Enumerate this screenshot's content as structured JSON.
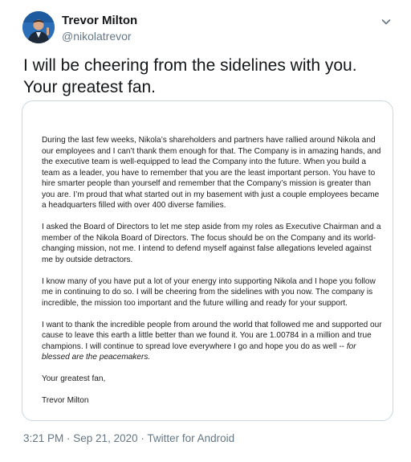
{
  "author": {
    "name": "Trevor Milton",
    "handle": "@nikolatrevor",
    "avatar": "avatar-photo"
  },
  "menu": {
    "icon": "chevron-down-icon"
  },
  "tweet": {
    "text": "I will be cheering from the sidelines with you. Your greatest fan."
  },
  "letter": {
    "paragraphs": [
      "During the last few weeks, Nikola’s shareholders and partners have rallied around Nikola and our employees and I can’t thank them enough for that.  The Company is in amazing hands, and the executive team is well-equipped to lead the Company into the future.  When you build a team as a leader, you have to remember that you are the least important person.  You have to hire smarter people than yourself and remember that the Company’s mission is greater than you are.  I’m proud that what started out in my basement with just a couple employees became a headquarters filled with over 400 diverse families.",
      "I asked the Board of Directors to let me step aside from my roles as Executive Chairman and a member of the Nikola Board of Directors.  The focus should be on the Company and its world-changing mission, not me. I intend to defend myself against false allegations leveled against me by outside detractors.",
      "I know many of you have put a lot of your energy into supporting Nikola and I hope you follow me in continuing to do so. I will be cheering from the sidelines with you now.  The company is incredible, the mission too important and the future willing and ready for your support.",
      "I want to thank the incredible people from around the world that followed me and supported our cause to leave this earth a little better than we found it.  You are 1.00784 in a million and true champions.  I will continue to spread love everywhere I go and hope you do as well --"
    ],
    "closing_italic": "for blessed are the peacemakers.",
    "signoff": "Your greatest fan,",
    "signature": "Trevor Milton"
  },
  "meta": {
    "time": "3:21 PM",
    "separator1": " · ",
    "date": "Sep 21, 2020",
    "separator2": " · ",
    "source": "Twitter for Android"
  }
}
